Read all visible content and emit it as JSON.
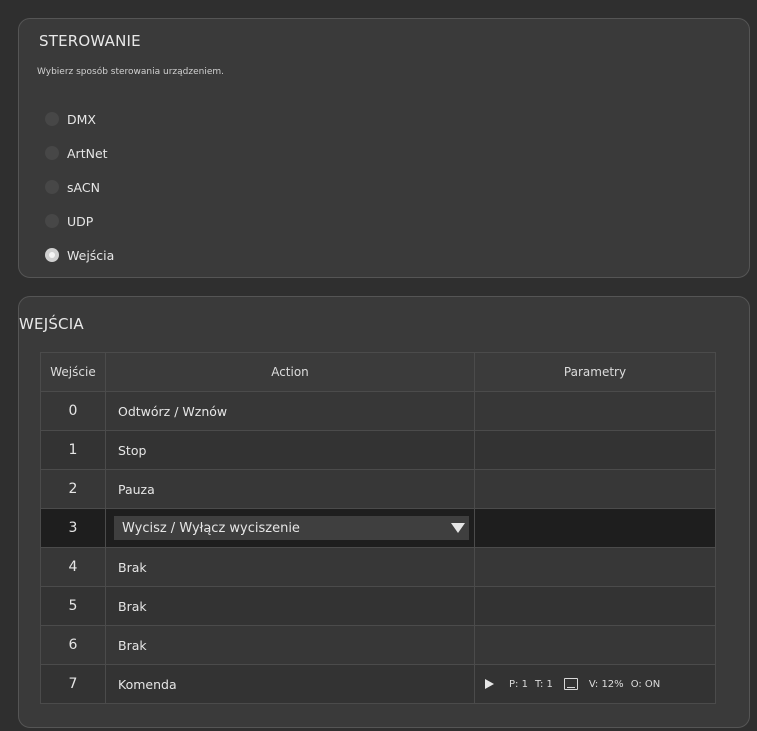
{
  "control": {
    "title": "STEROWANIE",
    "description": "Wybierz sposób sterowania urządzeniem.",
    "options": [
      {
        "label": "DMX",
        "checked": false
      },
      {
        "label": "ArtNet",
        "checked": false
      },
      {
        "label": "sACN",
        "checked": false
      },
      {
        "label": "UDP",
        "checked": false
      },
      {
        "label": "Wejścia",
        "checked": true
      }
    ]
  },
  "inputs": {
    "title": "WEJŚCIA",
    "columns": {
      "input": "Wejście",
      "action": "Action",
      "params": "Parametry"
    },
    "rows": [
      {
        "num": "0",
        "action": "Odtwórz / Wznów"
      },
      {
        "num": "1",
        "action": "Stop"
      },
      {
        "num": "2",
        "action": "Pauza"
      },
      {
        "num": "3",
        "action": "Wycisz / Wyłącz wyciszenie"
      },
      {
        "num": "4",
        "action": "Brak"
      },
      {
        "num": "5",
        "action": "Brak"
      },
      {
        "num": "6",
        "action": "Brak"
      },
      {
        "num": "7",
        "action": "Komenda"
      }
    ],
    "command_params": {
      "play_icon": "play-icon",
      "p": "P: 1",
      "t": "T: 1",
      "screen_icon": "screen-icon",
      "v": "V: 12%",
      "o": "O: ON"
    }
  }
}
